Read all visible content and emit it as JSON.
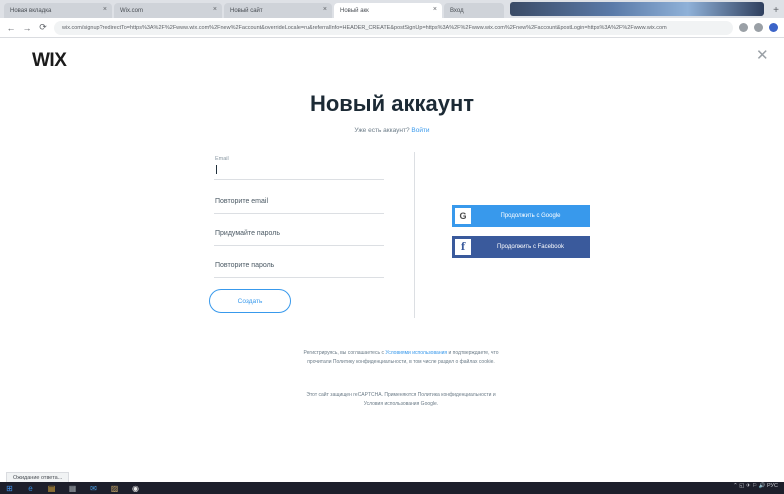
{
  "browser": {
    "tabs": [
      {
        "label": "Новая вкладка"
      },
      {
        "label": "Wix.com"
      },
      {
        "label": "Новый сайт"
      },
      {
        "label": "Новый акк"
      },
      {
        "label": "Вход"
      }
    ],
    "new_tab_symbol": "+",
    "tab_close_symbol": "×",
    "url": "wix.com/signup?redirectTo=https%3A%2F%2Fwww.wix.com%2Fnew%2Faccount&overrideLocale=ru&referralInfo=HEADER_CREATE&postSignUp=https%3A%2F%2Fwww.wix.com%2Fnew%2Faccount&postLogin=https%3A%2F%2Fwww.wix.com",
    "nav": {
      "back": "←",
      "forward": "→",
      "reload": "⟳"
    }
  },
  "page": {
    "logo": "WIX",
    "close_symbol": "✕",
    "title": "Новый аккаунт",
    "subtitle_text": "Уже есть аккаунт? ",
    "subtitle_link": "Войти"
  },
  "form": {
    "email_label": "Email",
    "repeat_email_placeholder": "Повторите email",
    "password_placeholder": "Придумайте пароль",
    "repeat_password_placeholder": "Повторите пароль",
    "submit_label": "Создать"
  },
  "social": {
    "google_icon": "G",
    "google_label": "Продолжить с Google",
    "facebook_icon": "f",
    "facebook_label": "Продолжить с Facebook"
  },
  "legal": {
    "line1_text": "Регистрируясь, вы соглашаетесь с ",
    "line1_link": "Условиями использования",
    "line1_rest": " и подтверждаете, что прочитали Политику конфиденциальности, в том числе раздел о файлах cookie.",
    "line2_text": "Этот сайт защищен reCAPTCHA. Применяются Политика конфиденциальности и Условия использования Google."
  },
  "status": "Ожидание ответа...",
  "taskbar": {
    "start": "⊞",
    "items": [
      "e",
      "▤",
      "▦",
      "✉",
      "▨",
      "◉"
    ],
    "tray": "⌃ ◱ ✈ ⚐ 🔊 РУС"
  }
}
